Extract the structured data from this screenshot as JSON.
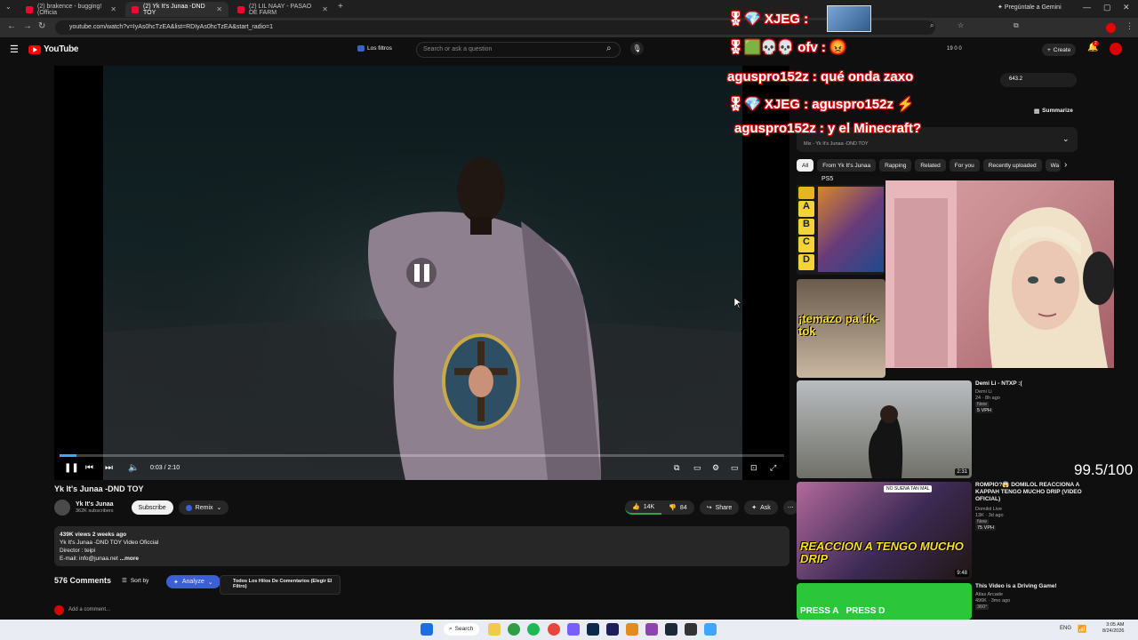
{
  "browser": {
    "tabs": [
      {
        "label": "(2) brakence - bugging! (Officia",
        "active": false
      },
      {
        "label": "(2) Yk It's Junaa -DND TOY",
        "active": true
      },
      {
        "label": "(2) LIL NAAY - PASAO DE FARM",
        "active": false
      }
    ],
    "url": "youtube.com/watch?v=IyAs0hcTzEA&list=RDIyAs0hcTzEA&start_radio=1",
    "gemini_label": "Pregúntale a Gemini"
  },
  "header": {
    "logo_text": "YouTube",
    "filter_label": "Los filtros",
    "search_placeholder": "Search or ask a question",
    "counters": "19  0  0",
    "create_label": "Create",
    "notif_count": "2"
  },
  "video": {
    "time": "0:03 / 2:10",
    "progress": 0.023,
    "title": "Yk It's Junaa -DND TOY"
  },
  "channel": {
    "name": "Yk It's Junaa",
    "subscribers": "362K subscribers",
    "subscribe_label": "Subscribe",
    "remix_label": "Remix"
  },
  "actions": {
    "likes": "14K",
    "dislikes": "84",
    "share_label": "Share",
    "ask_label": "Ask"
  },
  "description": {
    "views": "439K views  2 weeks ago",
    "line1": "Yk It's Junaa -DND TOY Video Oficcial",
    "line2": "Director : teipi",
    "line3": "E-mail: info@junaa.net",
    "more_label": "...more"
  },
  "comments": {
    "count_label": "576 Comments",
    "sort_label": "Sort by",
    "analyze_label": "Analyze",
    "filter_label": "Todos Los Hilos De Comentarios (Elegir El Filtro)",
    "add_placeholder": "Add a comment..."
  },
  "sidebar": {
    "summarize_label": "Summarize",
    "rating_value": "643.2",
    "mix_title": "Mix - Yk It's Junaa -DND TOY",
    "chips": [
      "All",
      "From Yk It's Junaa",
      "Rapping",
      "Related",
      "For you",
      "Recently uploaded",
      "Wa"
    ],
    "recommendations": [
      {
        "title": "Demi Li - NTXP :(",
        "channel": "Demi Li",
        "views": "24",
        "age": "8h ago",
        "badge": "New",
        "extra": "5 VPH",
        "duration": "2:31"
      },
      {
        "title": "ROMPIO?😱 DOMILOL REACCIONA A KAPPAH TENGO MUCHO DRIP (VIDEO OFICIAL)",
        "channel": "Domilol Live",
        "views": "13K",
        "age": "3d ago",
        "badge": "New",
        "extra": "75 VPH",
        "duration": "9:48",
        "thumb_banner": "NO SUENA TAN MAL",
        "thumb_text": "REACCION A TENGO MUCHO DRIP"
      },
      {
        "title": "This Video is a Driving Game!",
        "channel": "Atlas Arcade",
        "views": "496K",
        "age": "3mo ago",
        "badge": "360°",
        "thumb_text": "PRESS A   PRESS D"
      }
    ],
    "tier_labels": [
      "PS5",
      "A",
      "B",
      "C",
      "D"
    ],
    "temazo_text": "¡temazo pa tik-tok"
  },
  "overlay": {
    "chat": [
      {
        "user": "XJEG",
        "message": ""
      },
      {
        "user": "ofv",
        "message": ""
      },
      {
        "user": "aguspro152z",
        "message": "qué onda zaxo"
      },
      {
        "user": "XJEG",
        "message": "aguspro152z"
      },
      {
        "user": "aguspro152z",
        "message": "y el Minecraft?"
      }
    ],
    "score": "99.5/100"
  },
  "taskbar": {
    "search_label": "Search",
    "lang": "ENG",
    "time": "3:05 AM",
    "date": "8/24/2026"
  }
}
